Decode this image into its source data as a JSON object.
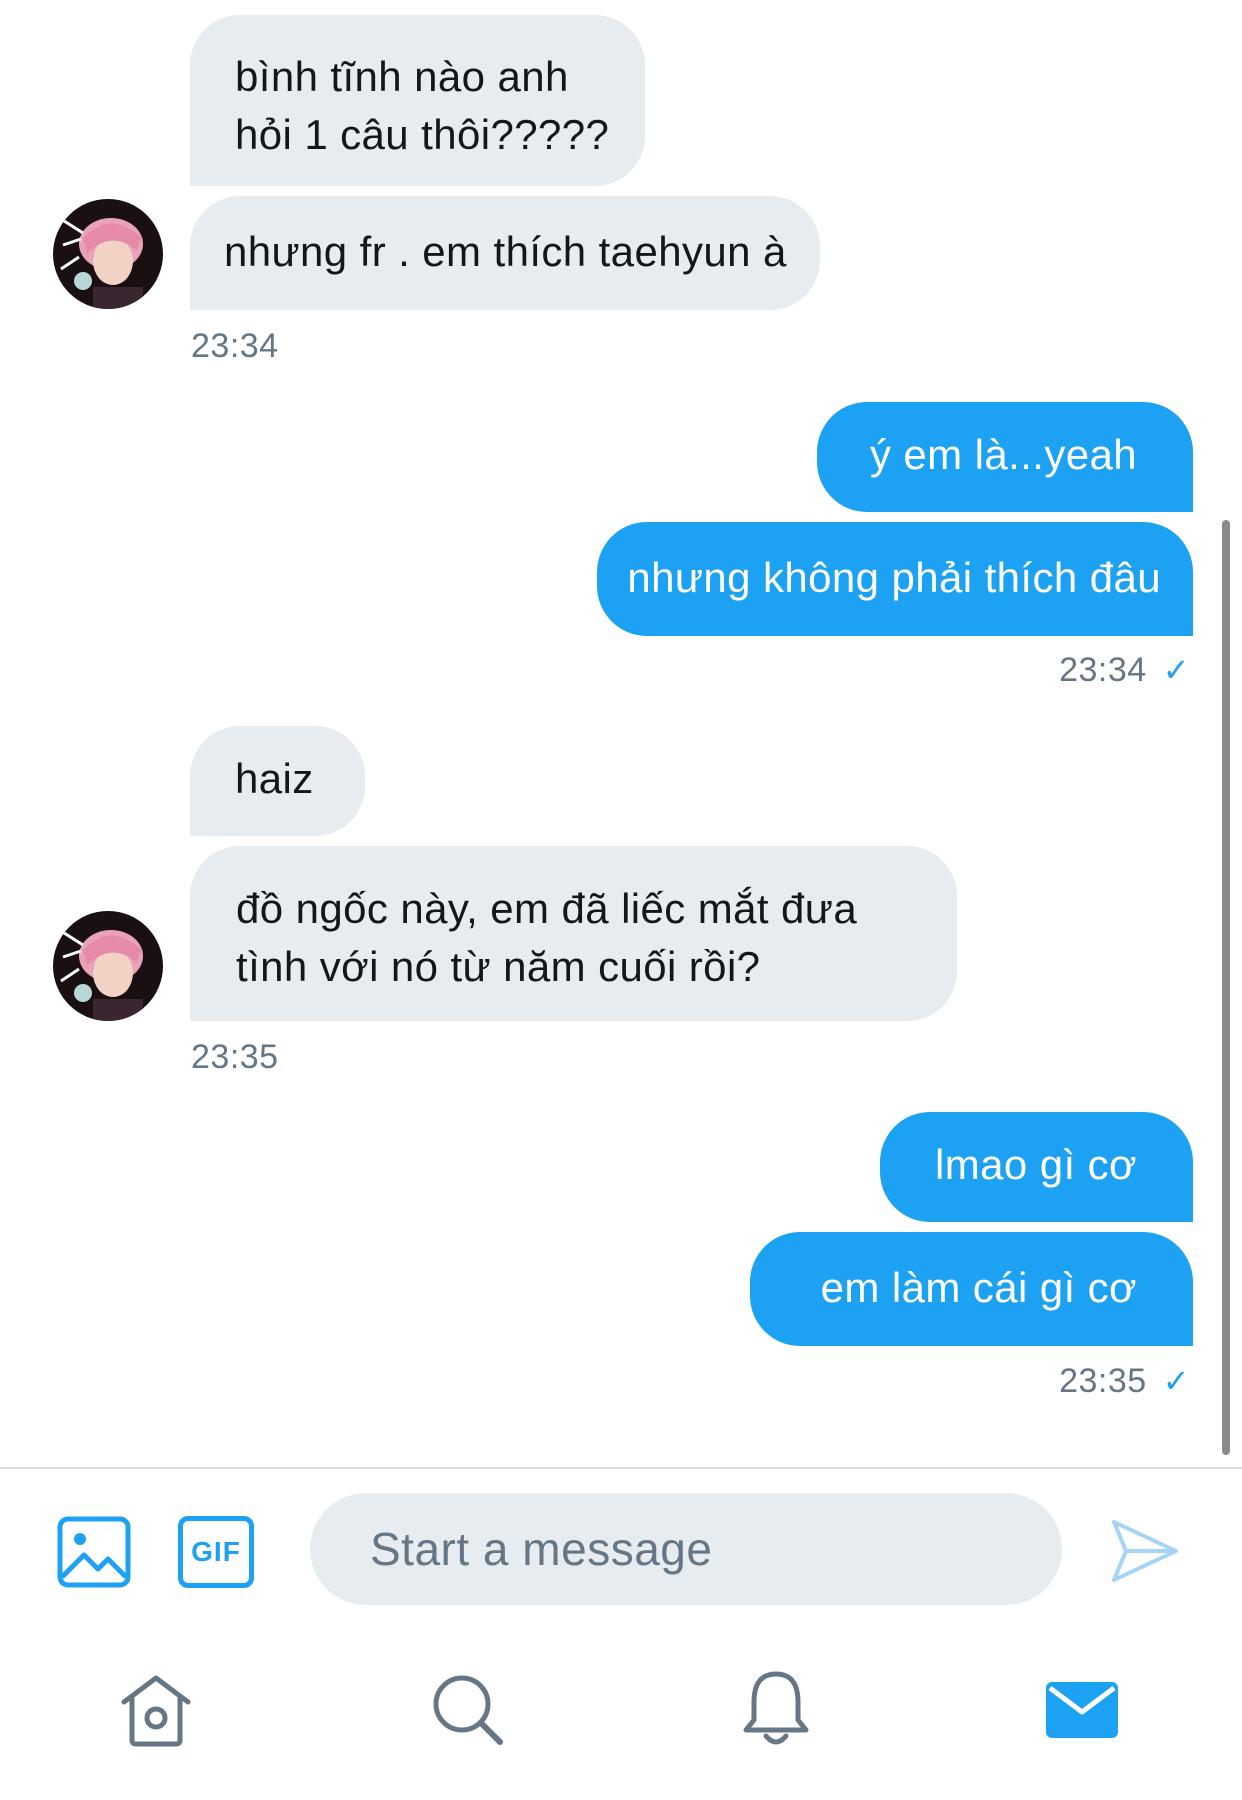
{
  "thread": {
    "groups": [
      {
        "messages": [
          {
            "line1": "bình tĩnh nào anh",
            "line2": "hỏi 1 câu thôi?????"
          },
          {
            "text": "nhưng fr . em thích taehyun à"
          }
        ],
        "time": "23:34"
      },
      {
        "messages": [
          {
            "text": "ý em là...yeah"
          },
          {
            "text": "nhưng không phải thích đâu"
          }
        ],
        "time": "23:34"
      },
      {
        "messages": [
          {
            "text": "haiz"
          },
          {
            "line1": "đồ ngốc này, em đã liếc mắt đưa",
            "line2": "tình với nó từ năm cuối rồi?"
          }
        ],
        "time": "23:35"
      },
      {
        "messages": [
          {
            "text": "lmao gì cơ"
          },
          {
            "text": "em làm cái gì cơ"
          }
        ],
        "time": "23:35"
      }
    ],
    "read_check": "✓"
  },
  "composer": {
    "image_icon": "image-icon",
    "gif_label": "GIF",
    "placeholder": "Start a message",
    "send_icon": "send-icon"
  },
  "tab_bar": {
    "items": [
      {
        "icon": "home-icon",
        "active": false
      },
      {
        "icon": "search-icon",
        "active": false
      },
      {
        "icon": "bell-icon",
        "active": false
      },
      {
        "icon": "mail-icon",
        "active": true
      }
    ]
  },
  "colors": {
    "accent": "#1da1f2",
    "incoming_bubble": "#e6ecf0",
    "timestamp": "#657786",
    "nav_icon": "#657786"
  }
}
